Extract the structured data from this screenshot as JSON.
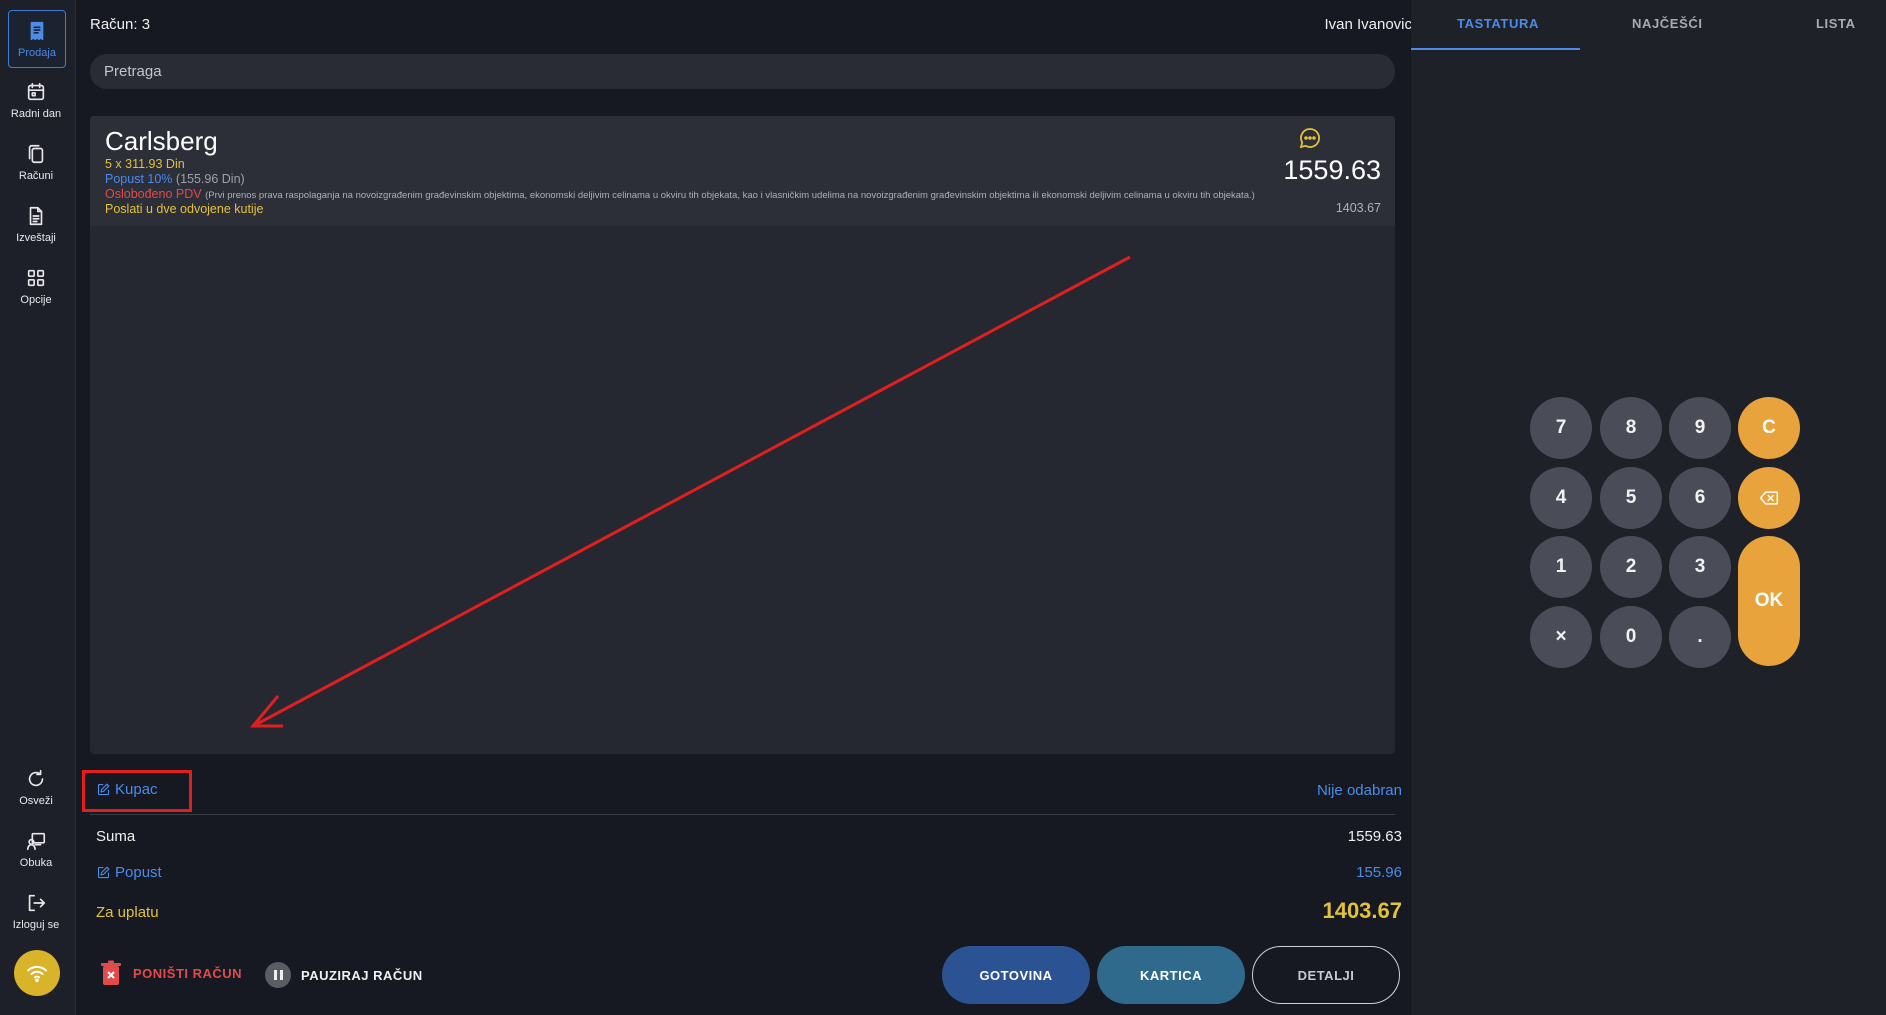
{
  "sidebar": {
    "items": [
      {
        "label": "Prodaja",
        "icon": "receipt-icon",
        "active": true
      },
      {
        "label": "Radni dan",
        "icon": "calendar-icon"
      },
      {
        "label": "Računi",
        "icon": "copy-icon"
      },
      {
        "label": "Izveštaji",
        "icon": "document-icon"
      },
      {
        "label": "Opcije",
        "icon": "grid-icon"
      },
      {
        "label": "Osveži",
        "icon": "refresh-icon"
      },
      {
        "label": "Obuka",
        "icon": "training-icon"
      },
      {
        "label": "Izloguj se",
        "icon": "logout-icon"
      }
    ],
    "wifi_icon": "wifi-icon"
  },
  "header": {
    "account": "Račun: 3",
    "user": "Ivan Ivanovic"
  },
  "search": {
    "placeholder": "Pretraga"
  },
  "items": [
    {
      "name": "Carlsberg",
      "qty_line": "5 x 311.93 Din",
      "discount_label": "Popust 10%",
      "discount_amount": "(155.96 Din)",
      "exempt_label": "Oslobođeno PDV",
      "exempt_note": "(Prvi prenos prava raspolaganja na novoizgrađenim građevinskim objektima, ekonomski deljivim celinama u okviru tih objekata, kao i vlasničkim udelima na novoizgrađenim građevinskim objektima ili ekonomski deljivim celinama u okviru tih objekata.)",
      "comment": "Poslati u dve odvojene kutije",
      "total": "1559.63",
      "net": "1403.67"
    }
  ],
  "summary": {
    "customer_label": "Kupac",
    "customer_value": "Nije odabran",
    "sum_label": "Suma",
    "sum_value": "1559.63",
    "discount_label": "Popust",
    "discount_value": "155.96",
    "pay_label": "Za uplatu",
    "pay_value": "1403.67"
  },
  "actions": {
    "cancel": "PONIŠTI RAČUN",
    "pause": "PAUZIRAJ RAČUN",
    "cash": "GOTOVINA",
    "card": "KARTICA",
    "details": "DETALJI"
  },
  "tabs": [
    {
      "label": "TASTATURA",
      "active": true
    },
    {
      "label": "NAJČEŠĆI"
    },
    {
      "label": "LISTA"
    }
  ],
  "keypad": {
    "k7": "7",
    "k8": "8",
    "k9": "9",
    "kc": "C",
    "k4": "4",
    "k5": "5",
    "k6": "6",
    "k1": "1",
    "k2": "2",
    "k3": "3",
    "kok": "OK",
    "kx": "×",
    "k0": "0",
    "kdot": "."
  },
  "colors": {
    "accent": "#4d8be8",
    "warning": "#e2c23a",
    "danger": "#e24b4b",
    "keypad_orange": "#e8a33c",
    "annotation": "#e01f1f"
  }
}
